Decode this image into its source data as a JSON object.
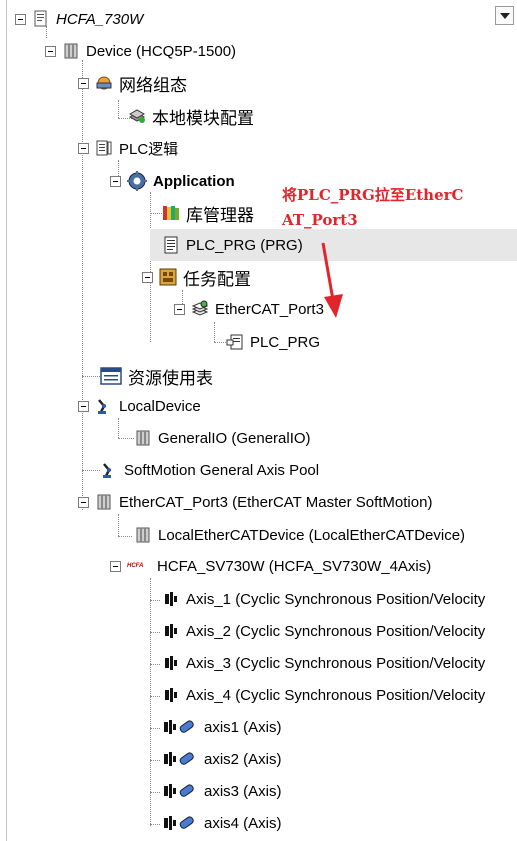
{
  "tree": {
    "project": "HCFA_730W",
    "device": "Device (HCQ5P-1500)",
    "network_config": "网络组态",
    "local_module_config": "本地模块配置",
    "plc_logic": "PLC逻辑",
    "application": "Application",
    "library_manager": "库管理器",
    "plc_prg": "PLC_PRG (PRG)",
    "task_config": "任务配置",
    "ethercat_task": "EtherCAT_Port3",
    "plc_prg_call": "PLC_PRG",
    "resource_usage": "资源使用表",
    "local_device": "LocalDevice",
    "general_io": "GeneralIO (GeneralIO)",
    "softmotion_pool": "SoftMotion General Axis Pool",
    "ethercat_master": "EtherCAT_Port3 (EtherCAT Master SoftMotion)",
    "local_ethercat_device": "LocalEtherCATDevice (LocalEtherCATDevice)",
    "servo": "HCFA_SV730W (HCFA_SV730W_4Axis)",
    "servo_icon_text": "HCFA",
    "channels": [
      "Axis_1 (Cyclic Synchronous Position/Velocity",
      "Axis_2 (Cyclic Synchronous Position/Velocity",
      "Axis_3 (Cyclic Synchronous Position/Velocity",
      "Axis_4 (Cyclic Synchronous Position/Velocity"
    ],
    "axes": [
      "axis1 (Axis)",
      "axis2 (Axis)",
      "axis3 (Axis)",
      "axis4 (Axis)"
    ]
  },
  "annotation": {
    "line1": "将PLC_PRG拉至EtherC",
    "line2": "AT_Port3",
    "color": "#e0262b"
  },
  "icons": {
    "project": "project-doc-icon",
    "device": "device-module-icon",
    "network": "network-config-icon",
    "logic": "plc-logic-icon",
    "application": "application-gear-icon",
    "library": "library-books-icon",
    "pou": "pou-document-icon",
    "task": "task-config-icon",
    "axis": "axis-motor-icon"
  }
}
